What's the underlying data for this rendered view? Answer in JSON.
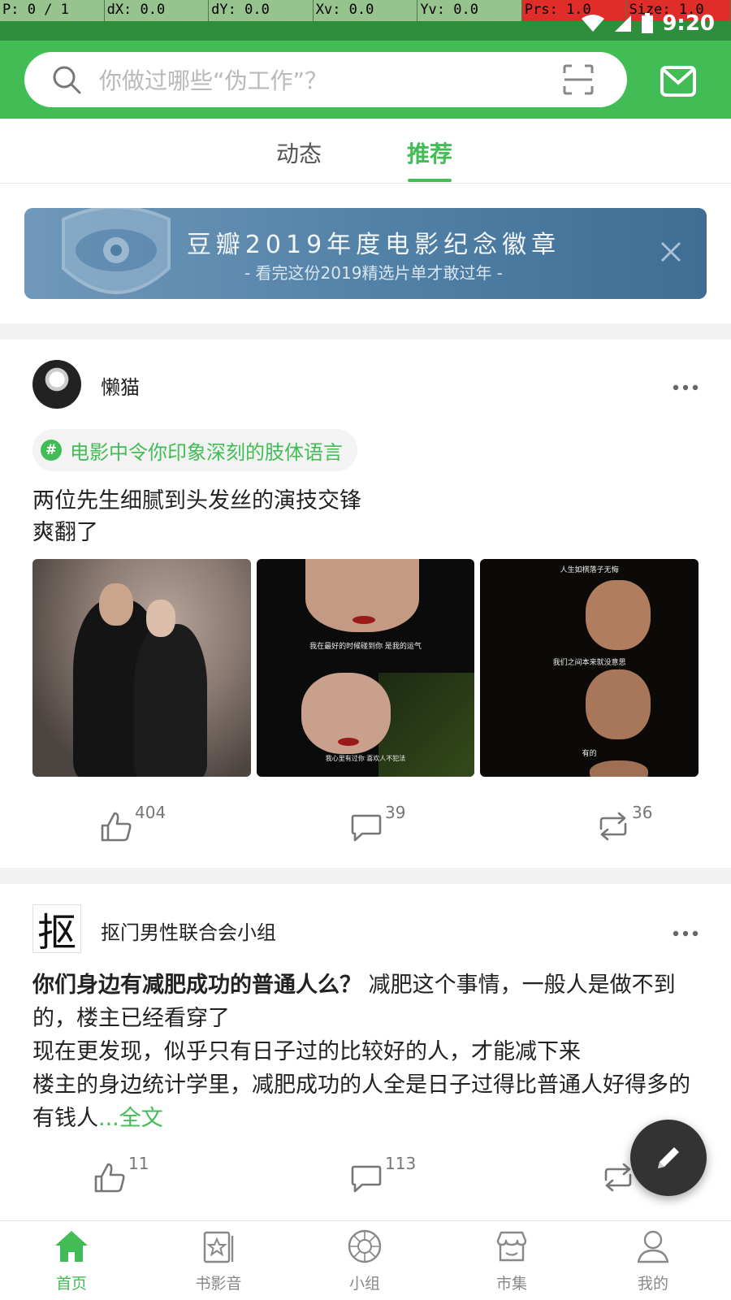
{
  "debug": {
    "p": "P: 0 / 1",
    "dx": "dX: 0.0",
    "dy": "dY: 0.0",
    "xv": "Xv: 0.0",
    "yv": "Yv: 0.0",
    "prs": "Prs: 1.0",
    "size": "Size: 1.0"
  },
  "status": {
    "time": "9:20"
  },
  "search": {
    "placeholder": "你做过哪些“伪工作”？"
  },
  "tabs": [
    {
      "label": "动态"
    },
    {
      "label": "推荐",
      "active": true
    }
  ],
  "banner": {
    "title": "豆瓣2019年度电影纪念徽章",
    "subtitle": "- 看完这份2019精选片单才敢过年 -"
  },
  "post1": {
    "username": "懒猫",
    "topic": "电影中令你印象深刻的肢体语言",
    "text_line1": "两位先生细腻到头发丝的演技交锋",
    "text_line2": "爽翻了",
    "photo2_caption1": "我在最好的时候碰到你 是我的运气",
    "photo2_caption2": "我心里有过你 喜欢人不犯法",
    "photo3_caption1": "人生如棋落子无悔",
    "photo3_caption2": "我们之间本来就没意思",
    "photo3_caption3": "有的",
    "likes": "404",
    "comments": "39",
    "reshares": "36"
  },
  "post2": {
    "username": "抠门男性联合会小组",
    "avatar_char": "抠",
    "title": "你们身边有减肥成功的普通人么？",
    "body_line1": " 减肥这个事情，一般人是做不到的，楼主已经看穿了",
    "body_line2": "现在更发现，似乎只有日子过的比较好的人，才能减下来",
    "body_line3": "楼主的身边统计学里，减肥成功的人全是日子过得比普通人好得多的有钱人",
    "more_link": "...全文",
    "likes": "11",
    "comments": "113"
  },
  "bottom_nav": [
    {
      "label": "首页",
      "icon": "home-icon",
      "active": true
    },
    {
      "label": "书影音",
      "icon": "book-film-icon"
    },
    {
      "label": "小组",
      "icon": "group-icon"
    },
    {
      "label": "市集",
      "icon": "market-icon"
    },
    {
      "label": "我的",
      "icon": "profile-icon"
    }
  ],
  "colors": {
    "accent": "#42bd56",
    "status_bar": "#2d8f3c"
  }
}
